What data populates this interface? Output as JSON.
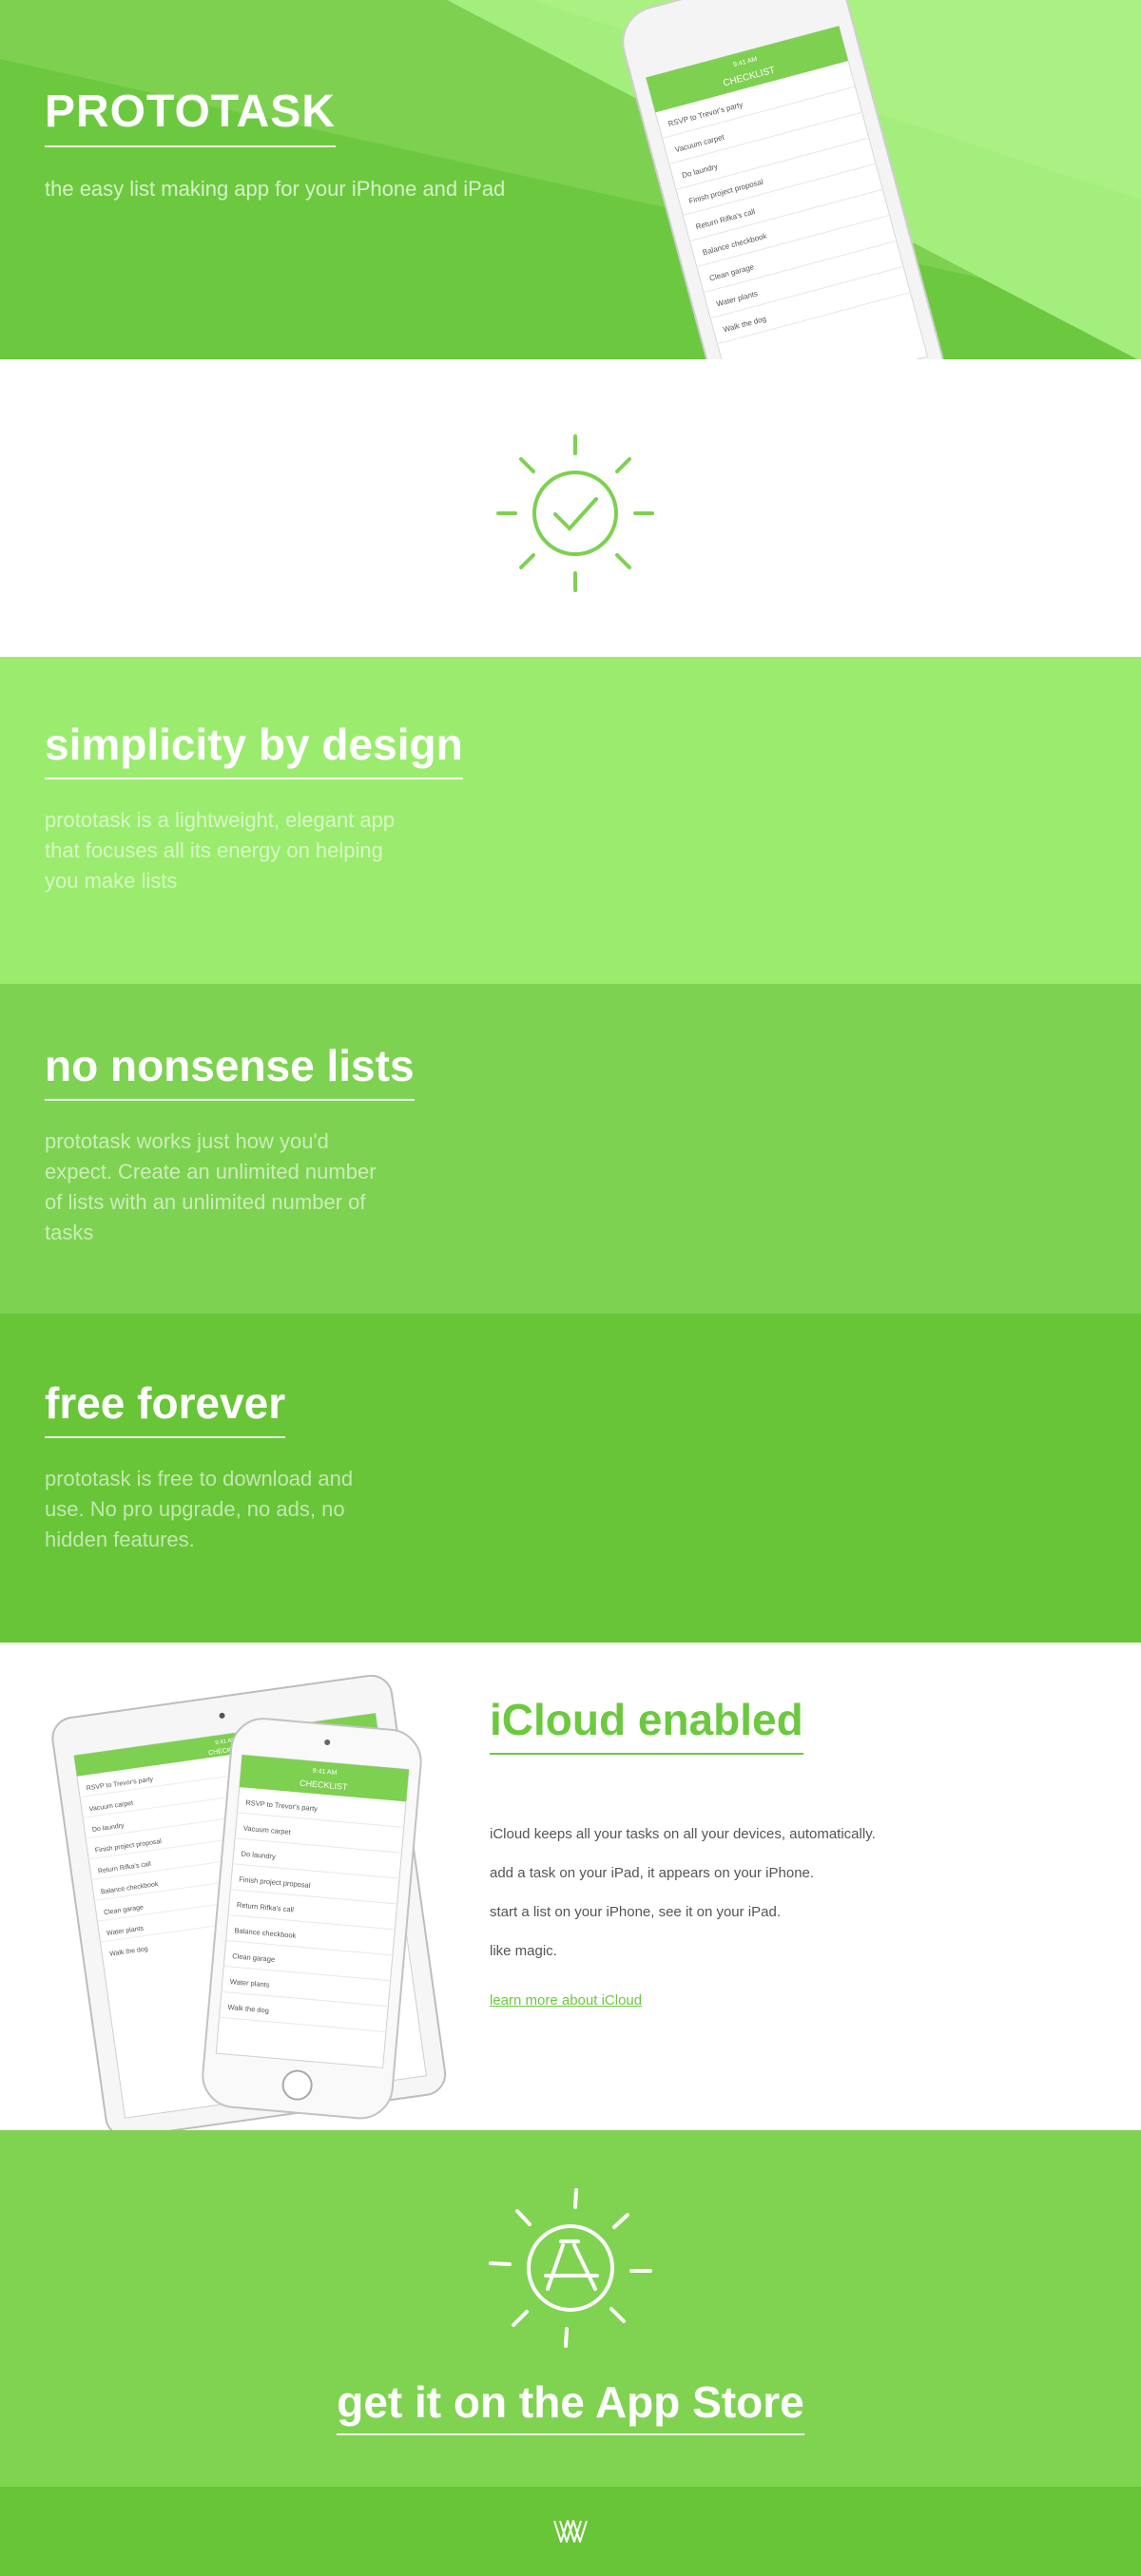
{
  "hero": {
    "title": "PROTOTASK",
    "subtitle": "the easy list making app for your iPhone and iPad"
  },
  "phone_ui": {
    "header_time": "9:41 AM",
    "header_title": "CHECKLIST",
    "items": [
      "RSVP to Trevor's party",
      "Vacuum carpet",
      "Do laundry",
      "Finish project proposal",
      "Return Rifka's call",
      "Balance checkbook",
      "Clean garage",
      "Water plants",
      "Walk the dog"
    ]
  },
  "features": [
    {
      "title": "simplicity by design",
      "body": "prototask is a lightweight, elegant app that focuses all its energy on helping you make lists"
    },
    {
      "title": "no nonsense lists",
      "body": "prototask works just how you'd expect. Create an unlimited number of lists with an unlimited number of tasks"
    },
    {
      "title": "free forever",
      "body": "prototask is free to download and use. No pro upgrade, no ads, no hidden features."
    }
  ],
  "icloud": {
    "title": "iCloud enabled",
    "lines": [
      "iCloud keeps all your tasks on all your devices, automatically.",
      "add a task on your iPad, it appears on your iPhone.",
      "start a list on your iPhone, see it on your iPad.",
      "like magic."
    ],
    "link": "learn more about iCloud"
  },
  "store": {
    "cta": "get it on the App Store"
  },
  "icons": {
    "logo": "sun-checkmark-icon",
    "app_store": "sun-app-store-icon",
    "footer": "ww-monogram-icon"
  },
  "colors": {
    "accent": "#6cc93f",
    "hero": "#7ed051",
    "band1": "#9bec6e",
    "band2": "#7ed251",
    "band3": "#68c538"
  }
}
